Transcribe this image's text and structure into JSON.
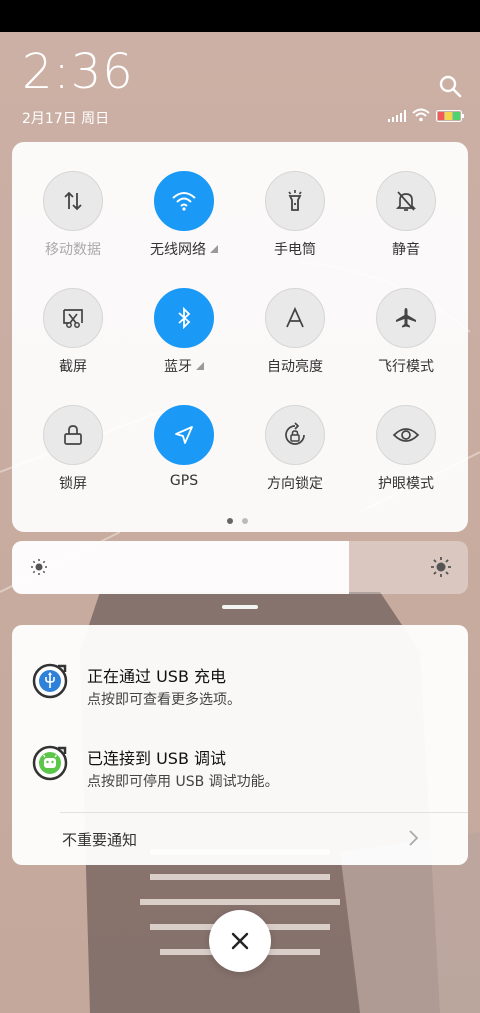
{
  "status": {
    "time": "2:36",
    "date": "2月17日 周日",
    "icons": [
      "signal-icon",
      "wifi-icon",
      "battery-icon"
    ]
  },
  "toggles": [
    {
      "label": "移动数据",
      "icon": "mobile-data-icon",
      "on": false,
      "dim": true,
      "expandable": false
    },
    {
      "label": "无线网络",
      "icon": "wifi-icon",
      "on": true,
      "dim": false,
      "expandable": true
    },
    {
      "label": "手电筒",
      "icon": "flashlight-icon",
      "on": false,
      "dim": false,
      "expandable": false
    },
    {
      "label": "静音",
      "icon": "mute-bell-icon",
      "on": false,
      "dim": false,
      "expandable": false
    },
    {
      "label": "截屏",
      "icon": "screenshot-icon",
      "on": false,
      "dim": false,
      "expandable": false
    },
    {
      "label": "蓝牙",
      "icon": "bluetooth-icon",
      "on": true,
      "dim": false,
      "expandable": true
    },
    {
      "label": "自动亮度",
      "icon": "auto-brightness-icon",
      "on": false,
      "dim": false,
      "expandable": false
    },
    {
      "label": "飞行模式",
      "icon": "airplane-icon",
      "on": false,
      "dim": false,
      "expandable": false
    },
    {
      "label": "锁屏",
      "icon": "lock-icon",
      "on": false,
      "dim": false,
      "expandable": false
    },
    {
      "label": "GPS",
      "icon": "gps-icon",
      "on": true,
      "dim": false,
      "expandable": false
    },
    {
      "label": "方向锁定",
      "icon": "rotation-lock-icon",
      "on": false,
      "dim": false,
      "expandable": false
    },
    {
      "label": "护眼模式",
      "icon": "eye-icon",
      "on": false,
      "dim": false,
      "expandable": false
    }
  ],
  "pager": {
    "pages": 2,
    "active": 0
  },
  "brightness": {
    "level": 0.74
  },
  "notifications": [
    {
      "title": "正在通过 USB 充电",
      "subtitle": "点按即可查看更多选项。",
      "icon": "usb-icon"
    },
    {
      "title": "已连接到 USB 调试",
      "subtitle": "点按即可停用 USB 调试功能。",
      "icon": "android-debug-icon"
    }
  ],
  "unimportant_label": "不重要通知",
  "colors": {
    "accent": "#1a9af6",
    "panel": "#ffffff"
  }
}
